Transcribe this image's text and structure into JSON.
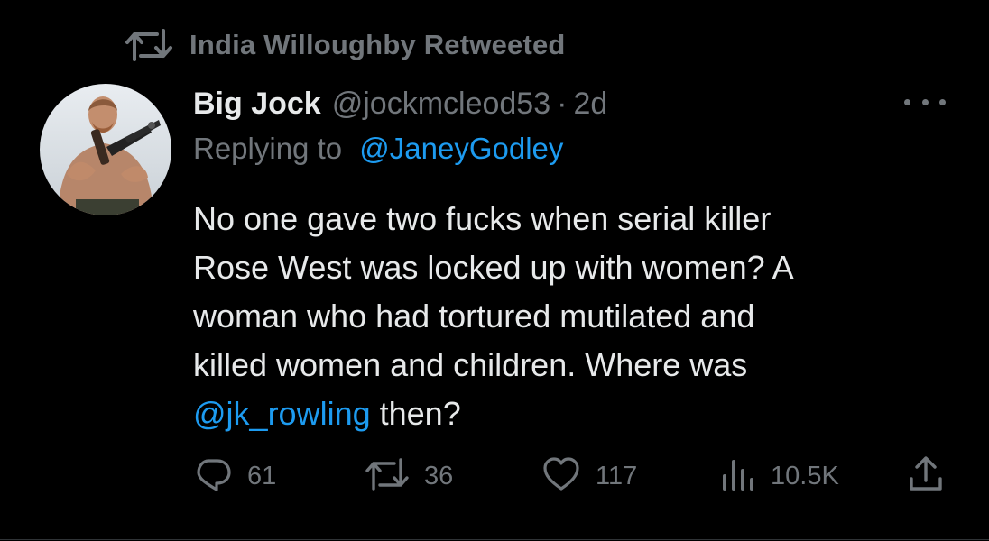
{
  "retweet_banner": {
    "icon": "retweet-icon",
    "text": "India Willoughby Retweeted"
  },
  "tweet": {
    "author": {
      "display_name": "Big Jock",
      "handle": "@jockmcleod53",
      "separator": "·",
      "timestamp": "2d",
      "avatar": "avatar-image"
    },
    "reply": {
      "prefix": "Replying to",
      "mention": "@JaneyGodley"
    },
    "body": {
      "line1": "No one gave two fucks when serial killer",
      "line2": "Rose West was locked up with women? A",
      "line3": "woman who had tortured mutilated and",
      "line4": "killed women and children. Where was",
      "mention": "@jk_rowling",
      "line5_rest": " then?"
    },
    "actions": {
      "replies": {
        "icon": "reply-icon",
        "count": "61"
      },
      "retweets": {
        "icon": "retweet-icon",
        "count": "36"
      },
      "likes": {
        "icon": "heart-icon",
        "count": "117"
      },
      "views": {
        "icon": "analytics-icon",
        "count": "10.5K"
      },
      "share": {
        "icon": "share-icon"
      }
    },
    "more_menu": {
      "icon": "more-icon"
    }
  },
  "colors": {
    "background": "#000000",
    "text_primary": "#e7e9ea",
    "text_secondary": "#71767b",
    "accent": "#1d9bf0"
  }
}
